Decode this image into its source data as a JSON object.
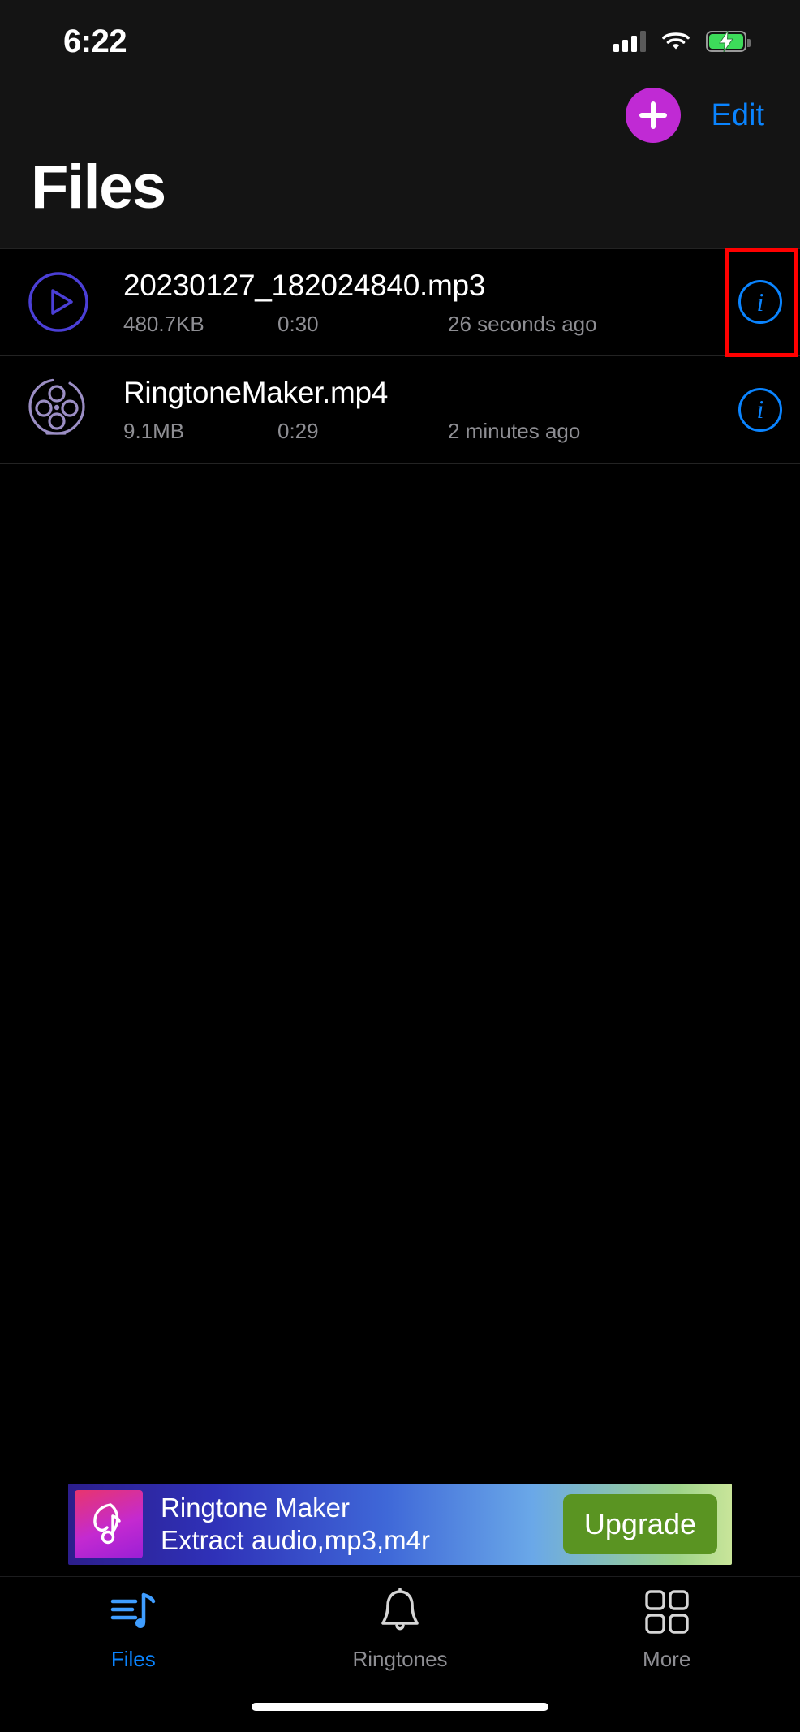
{
  "status_bar": {
    "time": "6:22",
    "cellular_icon": "cellular-signal-icon",
    "wifi_icon": "wifi-icon",
    "battery_icon": "battery-charging-icon",
    "battery_color": "#3ddc5a"
  },
  "nav": {
    "add_label": "+",
    "add_icon": "plus-icon",
    "add_color": "#c02ad4",
    "edit_label": "Edit",
    "edit_color": "#0a84ff"
  },
  "header": {
    "title": "Files"
  },
  "files": {
    "columns": [
      "name",
      "size",
      "duration",
      "modified"
    ],
    "items": [
      {
        "icon": "play-circle-icon",
        "icon_color": "#4b3fd6",
        "name": "20230127_182024840.mp3",
        "size": "480.7KB",
        "duration": "0:30",
        "modified": "26 seconds ago",
        "info_label": "i",
        "info_icon": "info-circle-icon",
        "highlighted": true,
        "highlight_color": "#ff0000"
      },
      {
        "icon": "film-reel-icon",
        "icon_color": "#9b8ec4",
        "name": "RingtoneMaker.mp4",
        "size": "9.1MB",
        "duration": "0:29",
        "modified": "2 minutes ago",
        "info_label": "i",
        "info_icon": "info-circle-icon",
        "highlighted": false,
        "highlight_color": "#ff0000"
      }
    ]
  },
  "ad": {
    "icon": "ringtone-maker-app-icon",
    "title": "Ringtone Maker",
    "subtitle": "Extract audio,mp3,m4r",
    "cta_label": "Upgrade",
    "cta_color": "#5a9422"
  },
  "tab_bar": {
    "items": [
      {
        "label": "Files",
        "icon": "music-list-icon",
        "active": true
      },
      {
        "label": "Ringtones",
        "icon": "bell-icon",
        "active": false
      },
      {
        "label": "More",
        "icon": "grid-four-squares-icon",
        "active": false
      }
    ],
    "active_color": "#0a84ff",
    "inactive_color": "#8e8e93"
  }
}
